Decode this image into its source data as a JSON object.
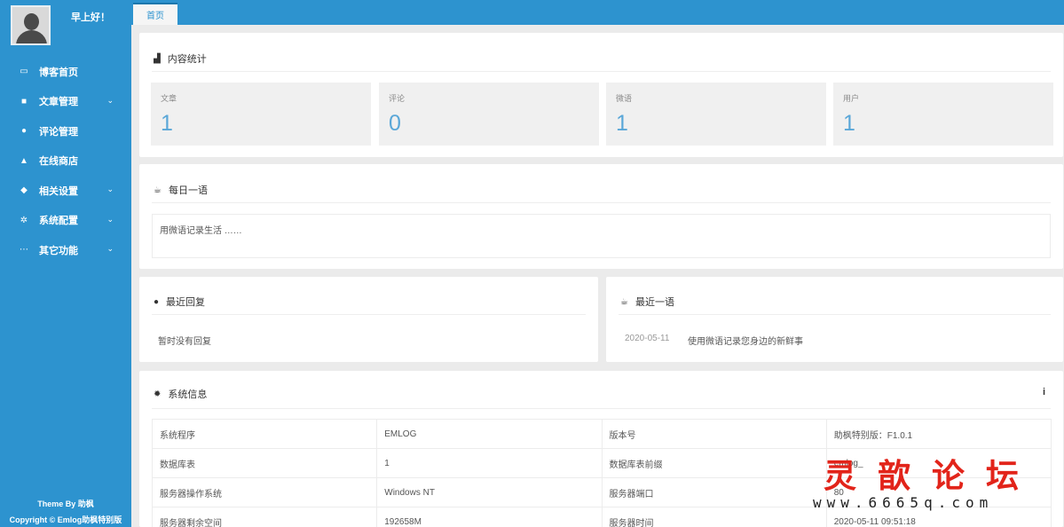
{
  "sidebar": {
    "greeting": "早上好！",
    "items": [
      {
        "icon": "monitor-icon",
        "glyph": "▭",
        "label": "博客首页",
        "has_submenu": false
      },
      {
        "icon": "document-icon",
        "glyph": "■",
        "label": "文章管理",
        "has_submenu": true
      },
      {
        "icon": "comments-icon",
        "glyph": "●",
        "label": "评论管理",
        "has_submenu": false
      },
      {
        "icon": "shopping-bag-icon",
        "glyph": "▲",
        "label": "在线商店",
        "has_submenu": false
      },
      {
        "icon": "cube-icon",
        "glyph": "◆",
        "label": "相关设置",
        "has_submenu": true
      },
      {
        "icon": "gears-icon",
        "glyph": "✲",
        "label": "系统配置",
        "has_submenu": true
      },
      {
        "icon": "ellipsis-icon",
        "glyph": "⋯",
        "label": "其它功能",
        "has_submenu": true
      }
    ],
    "footer_theme": "Theme By 助枫",
    "footer_copyright": "Copyright © Emlog助枫特别版"
  },
  "topbar": {
    "tab_label": "首页"
  },
  "content_stats": {
    "title": "内容统计",
    "icon": "bar-chart-icon",
    "items": [
      {
        "label": "文章",
        "value": "1"
      },
      {
        "label": "评论",
        "value": "0"
      },
      {
        "label": "微语",
        "value": "1"
      },
      {
        "label": "用户",
        "value": "1"
      }
    ]
  },
  "daily_quote": {
    "title": "每日一语",
    "icon": "coffee-icon",
    "text": "用微语记录生活 ……"
  },
  "recent_replies": {
    "title": "最近回复",
    "icon": "comments-icon",
    "empty_text": "暂时没有回复"
  },
  "recent_twitter": {
    "title": "最近一语",
    "icon": "coffee-icon",
    "date": "2020-05-11",
    "text": "使用微语记录您身边的新鲜事"
  },
  "system_info": {
    "title": "系统信息",
    "icon": "gear-icon",
    "rows": [
      [
        "系统程序",
        "EMLOG",
        "版本号",
        "助枫特别版：F1.0.1"
      ],
      [
        "数据库表",
        "1",
        "数据库表前缀",
        "emlog_"
      ],
      [
        "服务器操作系统",
        "Windows NT",
        "服务器端口",
        "80"
      ],
      [
        "服务器剩余空间",
        "192658M",
        "服务器时间",
        "2020-05-11 09:51:18"
      ]
    ]
  },
  "watermark": {
    "title": "灵歆论坛",
    "url": "www.6665q.com"
  },
  "colors": {
    "primary": "#2d93cf",
    "stat_value": "#5aa7d8",
    "watermark": "#e2241a"
  }
}
